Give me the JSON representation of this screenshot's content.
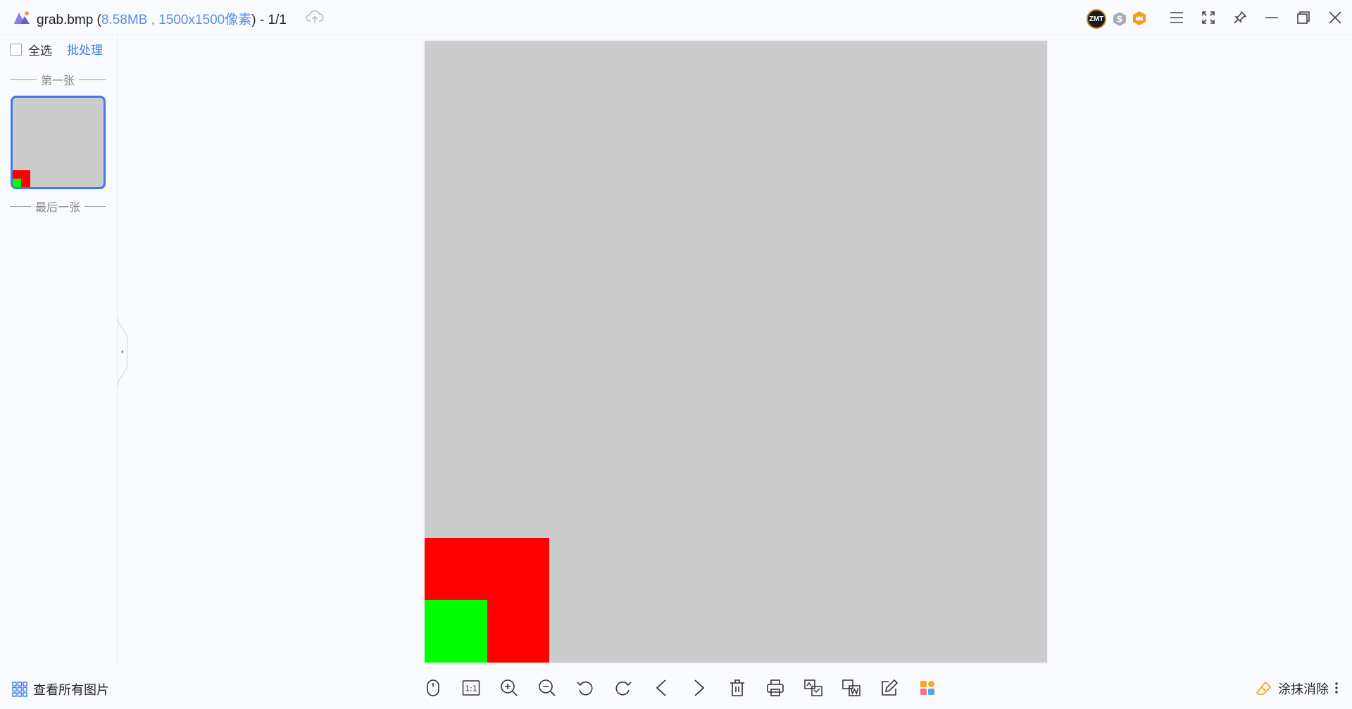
{
  "titlebar": {
    "filename": "grab.bmp",
    "open_paren": " (",
    "filesize": "8.58MB",
    "comma": " , ",
    "dimensions": "1500x1500像素",
    "close_paren": ")",
    "page_indicator": " - 1/1",
    "badges": [
      "ZMT"
    ],
    "window_buttons": [
      "menu-icon",
      "fullscreen-icon",
      "pin-icon",
      "minimize-icon",
      "restore-icon",
      "close-icon"
    ]
  },
  "sidebar": {
    "select_all_label": "全选",
    "batch_label": "批处理",
    "first_label": "第一张",
    "last_label": "最后一张"
  },
  "image": {
    "background_color": "#cccccc",
    "red_color": "#ff0000",
    "green_color": "#00ff00"
  },
  "bottombar": {
    "view_all_label": "查看所有图片",
    "one_to_one_label": "1:1",
    "erase_label": "涂抹消除",
    "tools": [
      "mouse-icon",
      "actual-size-icon",
      "zoom-in-icon",
      "zoom-out-icon",
      "rotate-left-icon",
      "rotate-right-icon",
      "previous-icon",
      "next-icon",
      "delete-icon",
      "print-icon",
      "convert-icon",
      "to-word-icon",
      "edit-icon",
      "apps-icon"
    ]
  },
  "colors": {
    "accent": "#3b7de8",
    "meta_text": "#5a8fe8"
  }
}
